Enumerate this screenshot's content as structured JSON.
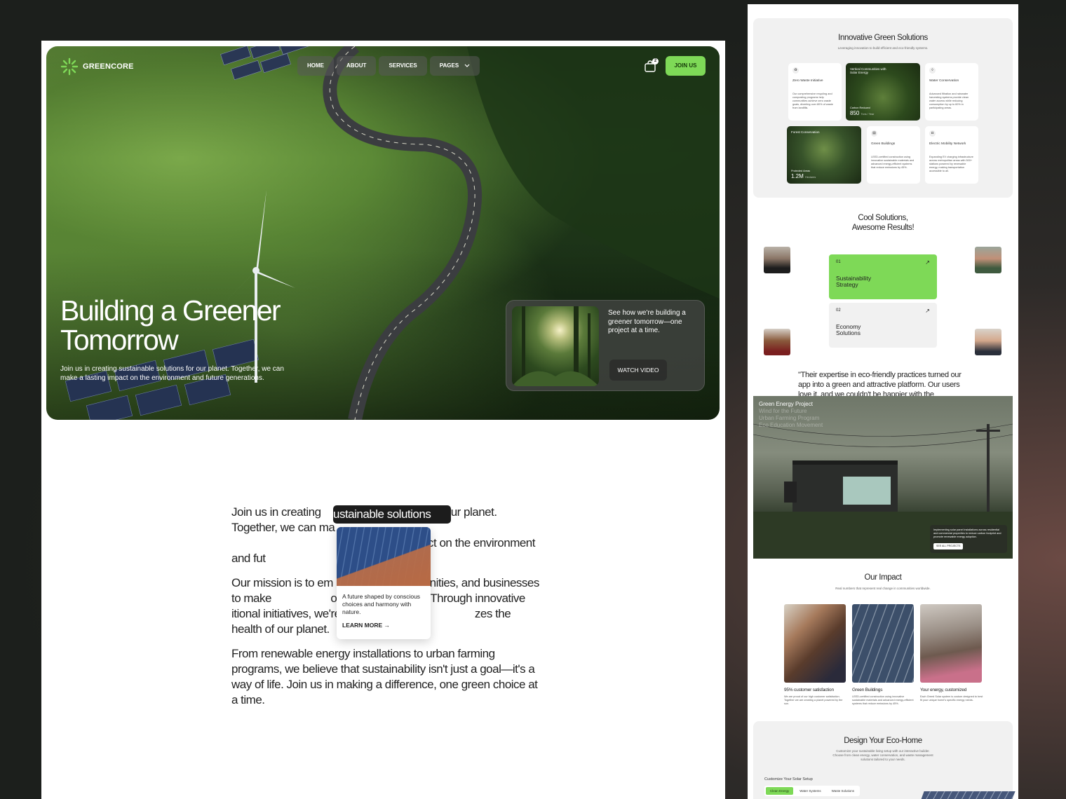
{
  "brand": {
    "name": "GREENCORE",
    "accent": "#7ed957"
  },
  "nav": {
    "items": [
      "HOME",
      "ABOUT",
      "SERVICES",
      "PAGES"
    ],
    "cart_count": "2",
    "join_label": "JOIN US"
  },
  "hero": {
    "title": "Building a Greener Tomorrow",
    "subtitle": "Join us in creating sustainable solutions for our planet. Together, we can make a lasting impact on the environment and future generations.",
    "video_text": "See how we're building a greener tomorrow—one project at a time.",
    "watch_label": "WATCH VIDEO"
  },
  "about": {
    "p1_a": "Join us in creating ",
    "p1_b": "our planet. Together, we can ma",
    "p1_c": "ct on the environment and fut",
    "highlight": "ustainable solutions",
    "p2": "Our mission is to em                    communities, and businesses to make                    onscious decisions. Through innovative                    itional initiatives, we're building a mov                    zes the health of our planet.",
    "p3": "From renewable energy installations to urban farming programs, we believe that sustainability isn't just a goal—it's a way of life. Join us in making a difference, one green choice at a time.",
    "card_text": "A future shaped by conscious choices and harmony with nature.",
    "card_link": "LEARN MORE →"
  },
  "solutions": {
    "title": "Innovative Green Solutions",
    "subtitle": "Leveraging innovation to build efficient and eco-friendly systems.",
    "cards": [
      {
        "title": "Zero Waste Initiative",
        "desc": "Our comprehensive recycling and composting programs help communities achieve zero waste goals, diverting over 80% of waste from landfills."
      },
      {
        "title": "Water Conservation",
        "desc": "Advanced filtration and rainwater harvesting systems provide clean water access while reducing consumption by up to 60% in participating areas."
      },
      {
        "title": "Green Buildings",
        "desc": "LEED-certified construction using innovative sustainable materials and advanced energy-efficient systems that reduce emissions by 45%."
      },
      {
        "title": "Electric Mobility Network",
        "desc": "Expanding EV charging infrastructure across metropolitan areas with 500+ stations powered by renewable energy, making transportation accessible to all."
      }
    ],
    "image_cards": [
      {
        "label": "Vertical Communities with Solar Energy",
        "stat_label": "Carbon Reduced",
        "stat": "850",
        "unit": "Tons / Year"
      },
      {
        "label": "Forest Conservation",
        "stat_label": "Protected Areas",
        "stat": "1.2M",
        "unit": "Hectares"
      }
    ]
  },
  "results": {
    "title": "Cool Solutions, Awesome Results!",
    "steps": [
      {
        "num": "01",
        "label": "Sustainability Strategy"
      },
      {
        "num": "02",
        "label": "Economy Solutions"
      }
    ],
    "quote": "\"Their expertise in eco-friendly practices turned our app into a green and attractive platform. Our users love it, and we couldn't be happier with the"
  },
  "projects": {
    "tabs": [
      "Green Energy Project",
      "Wind for the Future",
      "Urban Farming Program",
      "Eco Education Movement"
    ],
    "info": "Implementing solar panel installations across residential and commercial properties to reduce carbon footprint and promote renewable energy adoption.",
    "see_all": "SEE ALL PROJECTS"
  },
  "impact": {
    "title": "Our Impact",
    "subtitle": "Real numbers that represent real change in communities worldwide.",
    "items": [
      {
        "title": "95% customer satisfaction",
        "desc": "We are proud of our high customer satisfaction. Together we are creating a planet powered by the sun."
      },
      {
        "title": "Green Buildings",
        "desc": "LEED-certified construction using innovative sustainable materials and advanced energy-efficient systems that reduce emissions by 45%."
      },
      {
        "title": "Your energy, customized",
        "desc": "Each Greed Solar system is custom designed to best fit your unique home's specific energy needs."
      }
    ]
  },
  "eco_home": {
    "title": "Design Your Eco-Home",
    "subtitle": "Customize your sustainable living setup with our interactive builder. Choose from clean energy, water conservation, and waste management solutions tailored to your needs.",
    "setup_label": "Customize Your Solar Setup",
    "tabs": [
      "Clean Energy",
      "Water Systems",
      "Waste Solutions"
    ]
  }
}
